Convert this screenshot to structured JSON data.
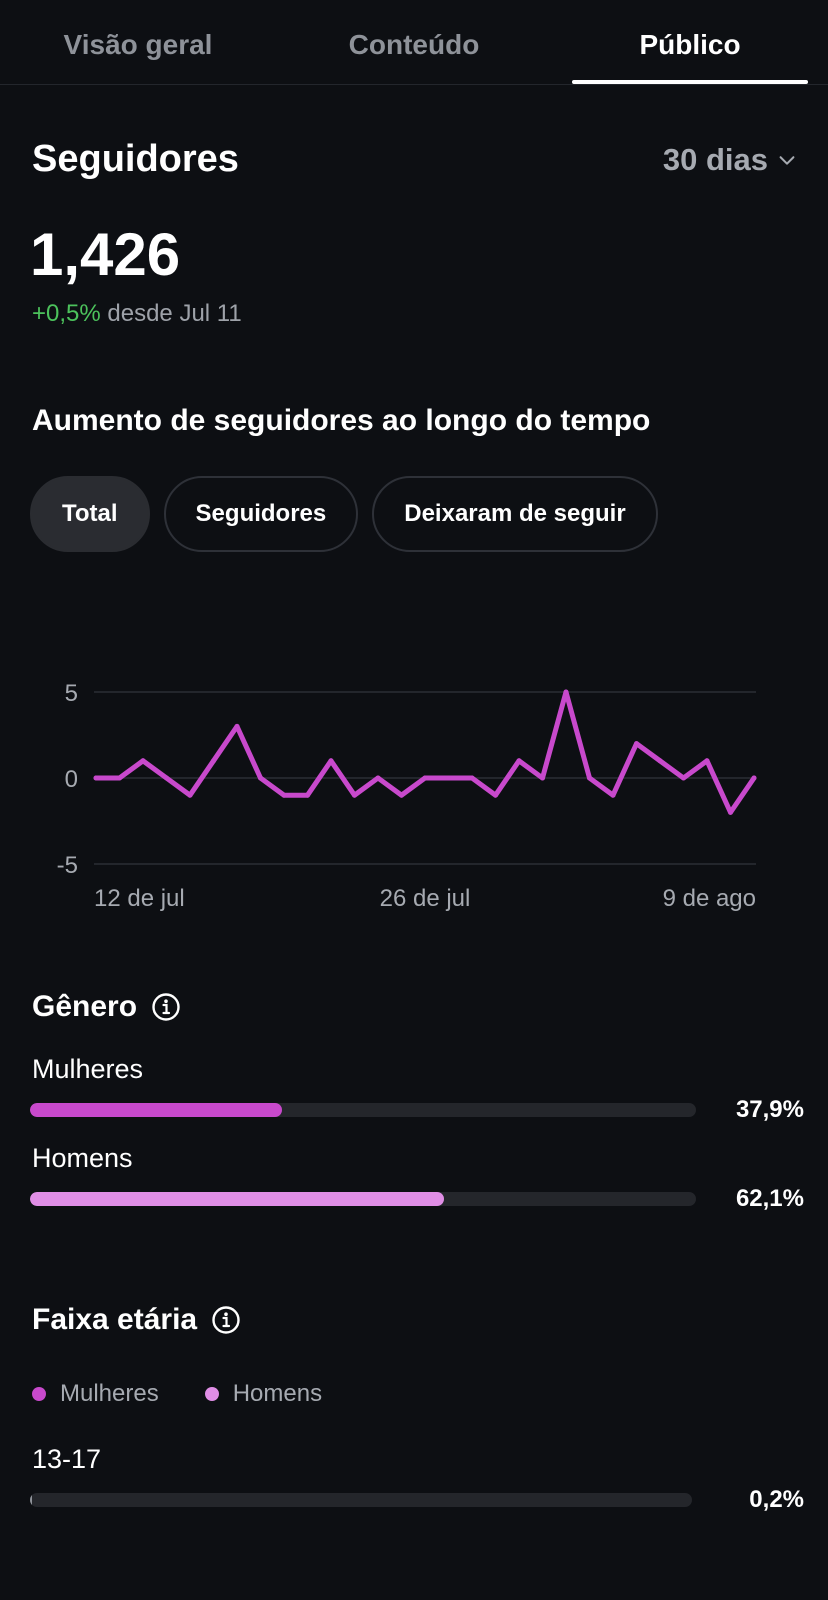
{
  "tabs": [
    {
      "label": "Visão geral",
      "active": false
    },
    {
      "label": "Conteúdo",
      "active": false
    },
    {
      "label": "Público",
      "active": true
    }
  ],
  "followers": {
    "title": "Seguidores",
    "period": "30 dias",
    "count": "1,426",
    "change_value": "+0,5%",
    "change_suffix": "desde Jul 11"
  },
  "growth": {
    "title": "Aumento de seguidores ao longo do tempo",
    "filters": [
      {
        "label": "Total",
        "active": true
      },
      {
        "label": "Seguidores",
        "active": false
      },
      {
        "label": "Deixaram de seguir",
        "active": false
      }
    ]
  },
  "chart_data": {
    "type": "line",
    "title": "",
    "xlabel": "",
    "ylabel": "",
    "ylim": [
      -5,
      5
    ],
    "yticks": [
      5,
      0,
      -5
    ],
    "xtick_labels": [
      {
        "label": "12 de jul",
        "index": 0
      },
      {
        "label": "26 de jul",
        "index": 14
      },
      {
        "label": "9 de ago",
        "index": 28
      }
    ],
    "grid": true,
    "series": [
      {
        "color": "#c849cc",
        "values": [
          0,
          0,
          1,
          0,
          -1,
          1,
          3,
          0,
          -1,
          -1,
          1,
          -1,
          0,
          -1,
          0,
          0,
          0,
          -1,
          1,
          0,
          5,
          0,
          -1,
          2,
          1,
          0,
          1,
          -2,
          0
        ]
      }
    ]
  },
  "gender": {
    "title": "Gênero",
    "bars": [
      {
        "label": "Mulheres",
        "percent_text": "37,9%",
        "value": 37.9,
        "color": "#c849cc"
      },
      {
        "label": "Homens",
        "percent_text": "62,1%",
        "value": 62.1,
        "color": "#e08ee6"
      }
    ]
  },
  "age": {
    "title": "Faixa etária",
    "legend": [
      {
        "label": "Mulheres",
        "color": "#c849cc"
      },
      {
        "label": "Homens",
        "color": "#e08ee6"
      }
    ],
    "groups": [
      {
        "label": "13-17",
        "percent_text": "0,2%",
        "value": 0.2
      }
    ]
  },
  "colors": {
    "background": "#0d0f13",
    "accent": "#c849cc",
    "accent_light": "#e08ee6",
    "positive": "#4cc25c"
  }
}
